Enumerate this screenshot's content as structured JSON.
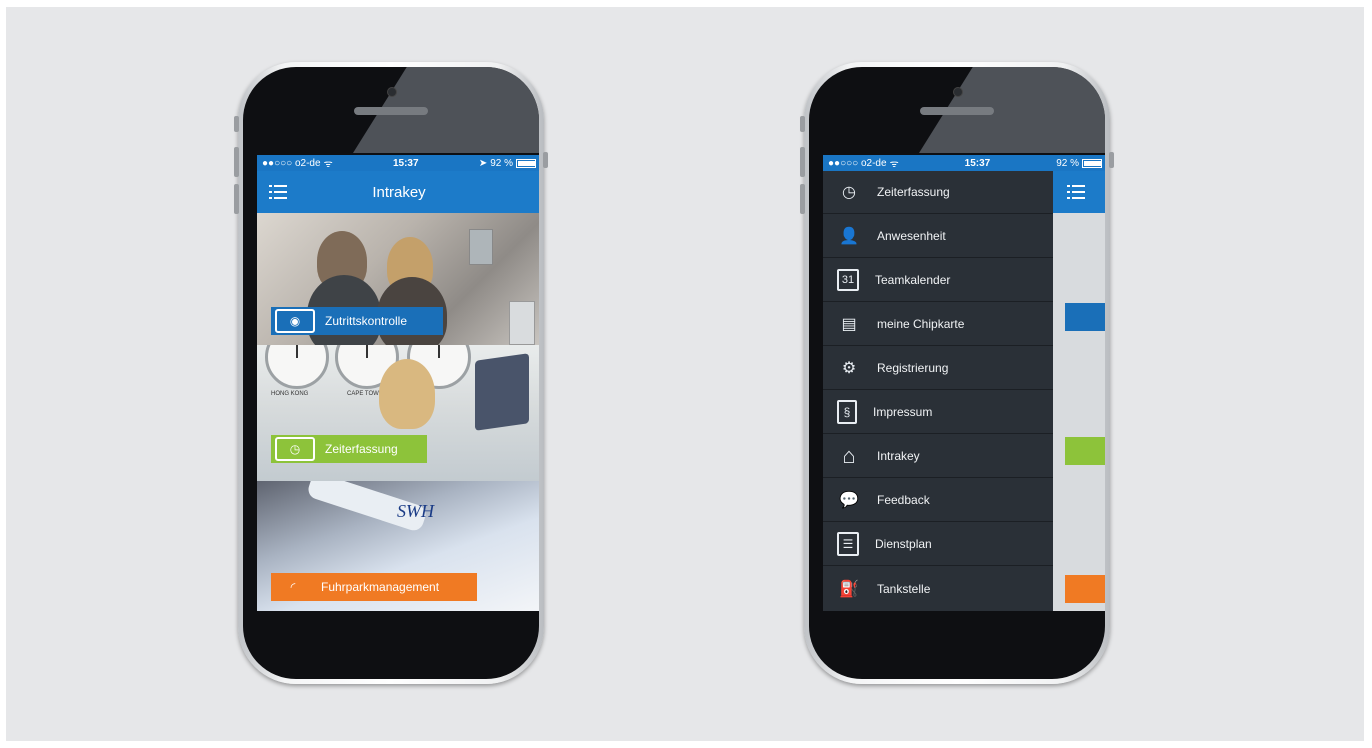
{
  "phone1": {
    "status": {
      "carrier": "●●○○○ o2-de",
      "wifi": "ᯤ",
      "time": "15:37",
      "location": "➤",
      "battery": "92 %",
      "battery_level": 0.92
    },
    "nav_title": "Intrakey",
    "tiles": [
      {
        "label": "Zutrittskontrolle",
        "icon": "eye-icon",
        "color": "#1a6fb8"
      },
      {
        "label": "Zeiterfassung",
        "icon": "clock-icon",
        "color": "#8dc33a"
      },
      {
        "label": "Fuhrparkmanagement",
        "icon": "gauge-icon",
        "color": "#f07a23"
      }
    ],
    "clock_labels": [
      "CAPE TOWN",
      "HONG KONG"
    ]
  },
  "phone2": {
    "status": {
      "carrier": "●●○○○ o2-de",
      "wifi": "ᯤ",
      "time": "15:37",
      "battery": "92 %",
      "battery_level": 0.92
    },
    "menu": [
      {
        "label": "Zeiterfassung",
        "icon": "clock-icon",
        "glyph": "◷"
      },
      {
        "label": "Anwesenheit",
        "icon": "person-icon",
        "glyph": "👤"
      },
      {
        "label": "Teamkalender",
        "icon": "calendar-icon",
        "glyph": "31"
      },
      {
        "label": "meine Chipkarte",
        "icon": "id-card-icon",
        "glyph": "▤"
      },
      {
        "label": "Registrierung",
        "icon": "gear-icon",
        "glyph": "⚙"
      },
      {
        "label": "Impressum",
        "icon": "document-icon",
        "glyph": "§"
      },
      {
        "label": "Intrakey",
        "icon": "home-icon",
        "glyph": "⌂"
      },
      {
        "label": "Feedback",
        "icon": "speech-bubble-icon",
        "glyph": "💬"
      },
      {
        "label": "Dienstplan",
        "icon": "clipboard-icon",
        "glyph": "☰"
      },
      {
        "label": "Tankstelle",
        "icon": "fuel-pump-icon",
        "glyph": "⛽"
      }
    ]
  }
}
